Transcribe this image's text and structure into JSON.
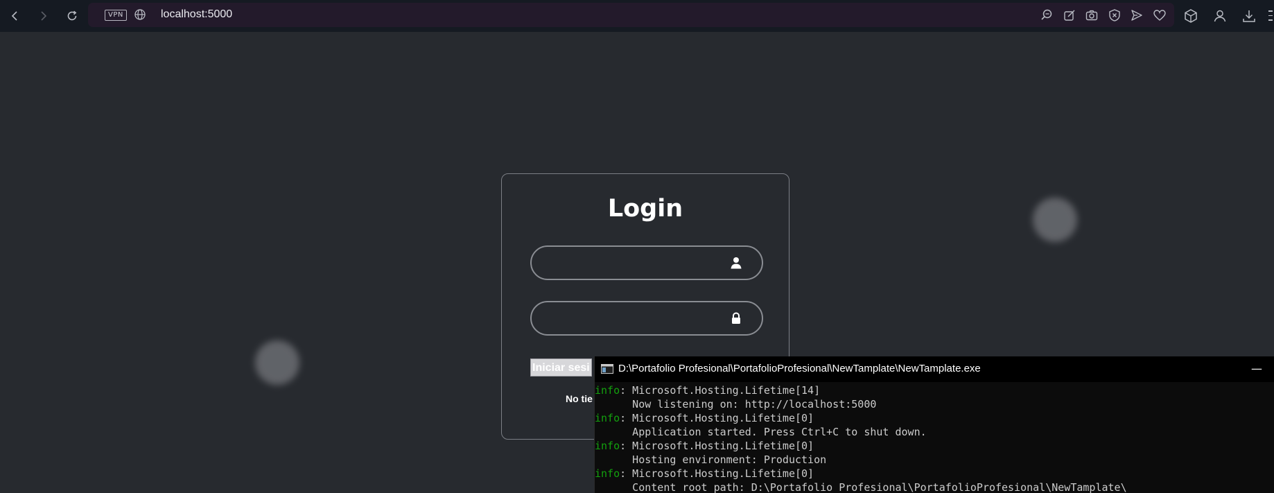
{
  "browser": {
    "url": "localhost:5000",
    "vpn_label": "VPN"
  },
  "login": {
    "title": "Login",
    "username": {
      "value": "",
      "placeholder": ""
    },
    "password": {
      "value": "",
      "placeholder": ""
    },
    "submit_label": "Iniciar sesi",
    "register_text": "No tie"
  },
  "console": {
    "title": "D:\\Portafolio Profesional\\PortafolioProfesional\\NewTamplate\\NewTamplate.exe",
    "minimize_glyph": "—",
    "lines": [
      {
        "level": "info",
        "text": ": Microsoft.Hosting.Lifetime[14]"
      },
      {
        "level": "",
        "text": "      Now listening on: http://localhost:5000"
      },
      {
        "level": "info",
        "text": ": Microsoft.Hosting.Lifetime[0]"
      },
      {
        "level": "",
        "text": "      Application started. Press Ctrl+C to shut down."
      },
      {
        "level": "info",
        "text": ": Microsoft.Hosting.Lifetime[0]"
      },
      {
        "level": "",
        "text": "      Hosting environment: Production"
      },
      {
        "level": "info",
        "text": ": Microsoft.Hosting.Lifetime[0]"
      },
      {
        "level": "",
        "text": "      Content root path: D:\\Portafolio Profesional\\PortafolioProfesional\\NewTamplate\\"
      }
    ]
  },
  "colors": {
    "page_bg": "#272a2f",
    "toolbar_bg": "#151a22",
    "address_bg": "#231a2b",
    "console_info": "#13a10e"
  }
}
